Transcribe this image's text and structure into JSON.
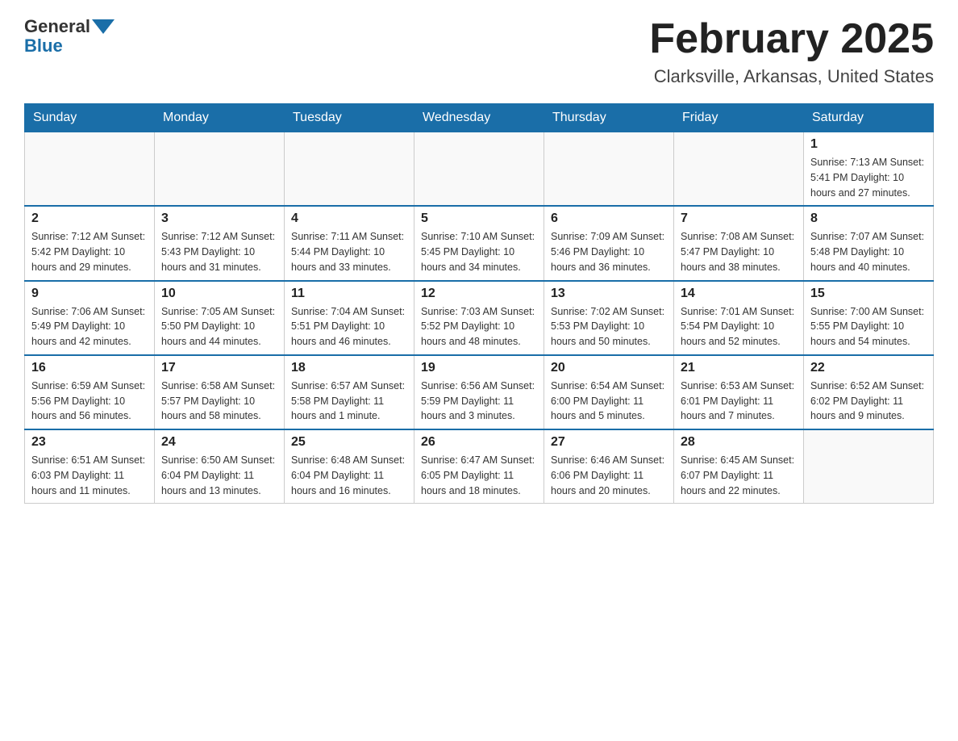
{
  "header": {
    "logo_text_general": "General",
    "logo_text_blue": "Blue",
    "title": "February 2025",
    "subtitle": "Clarksville, Arkansas, United States"
  },
  "days_of_week": [
    "Sunday",
    "Monday",
    "Tuesday",
    "Wednesday",
    "Thursday",
    "Friday",
    "Saturday"
  ],
  "weeks": [
    [
      {
        "day": "",
        "info": ""
      },
      {
        "day": "",
        "info": ""
      },
      {
        "day": "",
        "info": ""
      },
      {
        "day": "",
        "info": ""
      },
      {
        "day": "",
        "info": ""
      },
      {
        "day": "",
        "info": ""
      },
      {
        "day": "1",
        "info": "Sunrise: 7:13 AM\nSunset: 5:41 PM\nDaylight: 10 hours and 27 minutes."
      }
    ],
    [
      {
        "day": "2",
        "info": "Sunrise: 7:12 AM\nSunset: 5:42 PM\nDaylight: 10 hours and 29 minutes."
      },
      {
        "day": "3",
        "info": "Sunrise: 7:12 AM\nSunset: 5:43 PM\nDaylight: 10 hours and 31 minutes."
      },
      {
        "day": "4",
        "info": "Sunrise: 7:11 AM\nSunset: 5:44 PM\nDaylight: 10 hours and 33 minutes."
      },
      {
        "day": "5",
        "info": "Sunrise: 7:10 AM\nSunset: 5:45 PM\nDaylight: 10 hours and 34 minutes."
      },
      {
        "day": "6",
        "info": "Sunrise: 7:09 AM\nSunset: 5:46 PM\nDaylight: 10 hours and 36 minutes."
      },
      {
        "day": "7",
        "info": "Sunrise: 7:08 AM\nSunset: 5:47 PM\nDaylight: 10 hours and 38 minutes."
      },
      {
        "day": "8",
        "info": "Sunrise: 7:07 AM\nSunset: 5:48 PM\nDaylight: 10 hours and 40 minutes."
      }
    ],
    [
      {
        "day": "9",
        "info": "Sunrise: 7:06 AM\nSunset: 5:49 PM\nDaylight: 10 hours and 42 minutes."
      },
      {
        "day": "10",
        "info": "Sunrise: 7:05 AM\nSunset: 5:50 PM\nDaylight: 10 hours and 44 minutes."
      },
      {
        "day": "11",
        "info": "Sunrise: 7:04 AM\nSunset: 5:51 PM\nDaylight: 10 hours and 46 minutes."
      },
      {
        "day": "12",
        "info": "Sunrise: 7:03 AM\nSunset: 5:52 PM\nDaylight: 10 hours and 48 minutes."
      },
      {
        "day": "13",
        "info": "Sunrise: 7:02 AM\nSunset: 5:53 PM\nDaylight: 10 hours and 50 minutes."
      },
      {
        "day": "14",
        "info": "Sunrise: 7:01 AM\nSunset: 5:54 PM\nDaylight: 10 hours and 52 minutes."
      },
      {
        "day": "15",
        "info": "Sunrise: 7:00 AM\nSunset: 5:55 PM\nDaylight: 10 hours and 54 minutes."
      }
    ],
    [
      {
        "day": "16",
        "info": "Sunrise: 6:59 AM\nSunset: 5:56 PM\nDaylight: 10 hours and 56 minutes."
      },
      {
        "day": "17",
        "info": "Sunrise: 6:58 AM\nSunset: 5:57 PM\nDaylight: 10 hours and 58 minutes."
      },
      {
        "day": "18",
        "info": "Sunrise: 6:57 AM\nSunset: 5:58 PM\nDaylight: 11 hours and 1 minute."
      },
      {
        "day": "19",
        "info": "Sunrise: 6:56 AM\nSunset: 5:59 PM\nDaylight: 11 hours and 3 minutes."
      },
      {
        "day": "20",
        "info": "Sunrise: 6:54 AM\nSunset: 6:00 PM\nDaylight: 11 hours and 5 minutes."
      },
      {
        "day": "21",
        "info": "Sunrise: 6:53 AM\nSunset: 6:01 PM\nDaylight: 11 hours and 7 minutes."
      },
      {
        "day": "22",
        "info": "Sunrise: 6:52 AM\nSunset: 6:02 PM\nDaylight: 11 hours and 9 minutes."
      }
    ],
    [
      {
        "day": "23",
        "info": "Sunrise: 6:51 AM\nSunset: 6:03 PM\nDaylight: 11 hours and 11 minutes."
      },
      {
        "day": "24",
        "info": "Sunrise: 6:50 AM\nSunset: 6:04 PM\nDaylight: 11 hours and 13 minutes."
      },
      {
        "day": "25",
        "info": "Sunrise: 6:48 AM\nSunset: 6:04 PM\nDaylight: 11 hours and 16 minutes."
      },
      {
        "day": "26",
        "info": "Sunrise: 6:47 AM\nSunset: 6:05 PM\nDaylight: 11 hours and 18 minutes."
      },
      {
        "day": "27",
        "info": "Sunrise: 6:46 AM\nSunset: 6:06 PM\nDaylight: 11 hours and 20 minutes."
      },
      {
        "day": "28",
        "info": "Sunrise: 6:45 AM\nSunset: 6:07 PM\nDaylight: 11 hours and 22 minutes."
      },
      {
        "day": "",
        "info": ""
      }
    ]
  ]
}
